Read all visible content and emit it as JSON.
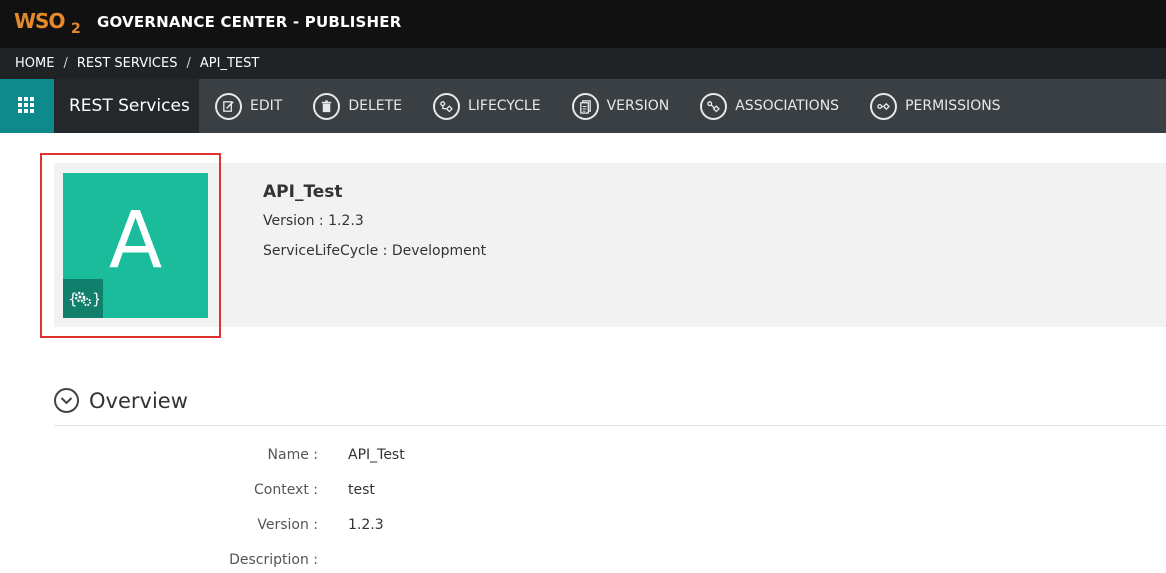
{
  "header": {
    "logo_text": "WSO",
    "logo_sub": "2",
    "title": "GOVERNANCE CENTER - PUBLISHER"
  },
  "breadcrumb": {
    "items": [
      "HOME",
      "REST SERVICES",
      "API_TEST"
    ],
    "separator": "/"
  },
  "actionbar": {
    "section_title": "REST Services",
    "actions": [
      {
        "label": "EDIT",
        "icon": "edit-icon"
      },
      {
        "label": "DELETE",
        "icon": "trash-icon"
      },
      {
        "label": "LIFECYCLE",
        "icon": "lifecycle-icon"
      },
      {
        "label": "VERSION",
        "icon": "version-icon"
      },
      {
        "label": "ASSOCIATIONS",
        "icon": "associations-icon"
      },
      {
        "label": "PERMISSIONS",
        "icon": "permissions-icon"
      }
    ]
  },
  "asset": {
    "thumbnail_letter": "A",
    "badge_icon": "rest-service-gears-icon",
    "name": "API_Test",
    "version_line": "Version : 1.2.3",
    "lifecycle_line": "ServiceLifeCycle : Development"
  },
  "overview": {
    "title": "Overview",
    "rows": [
      {
        "label": "Name :",
        "value": "API_Test"
      },
      {
        "label": "Context :",
        "value": "test"
      },
      {
        "label": "Version :",
        "value": "1.2.3"
      },
      {
        "label": "Description :",
        "value": ""
      }
    ]
  },
  "colors": {
    "accent_teal": "#0f8a8c",
    "thumbnail_green": "#1abc9c",
    "highlight_red": "#e0322e",
    "logo_orange": "#e58a2a"
  }
}
